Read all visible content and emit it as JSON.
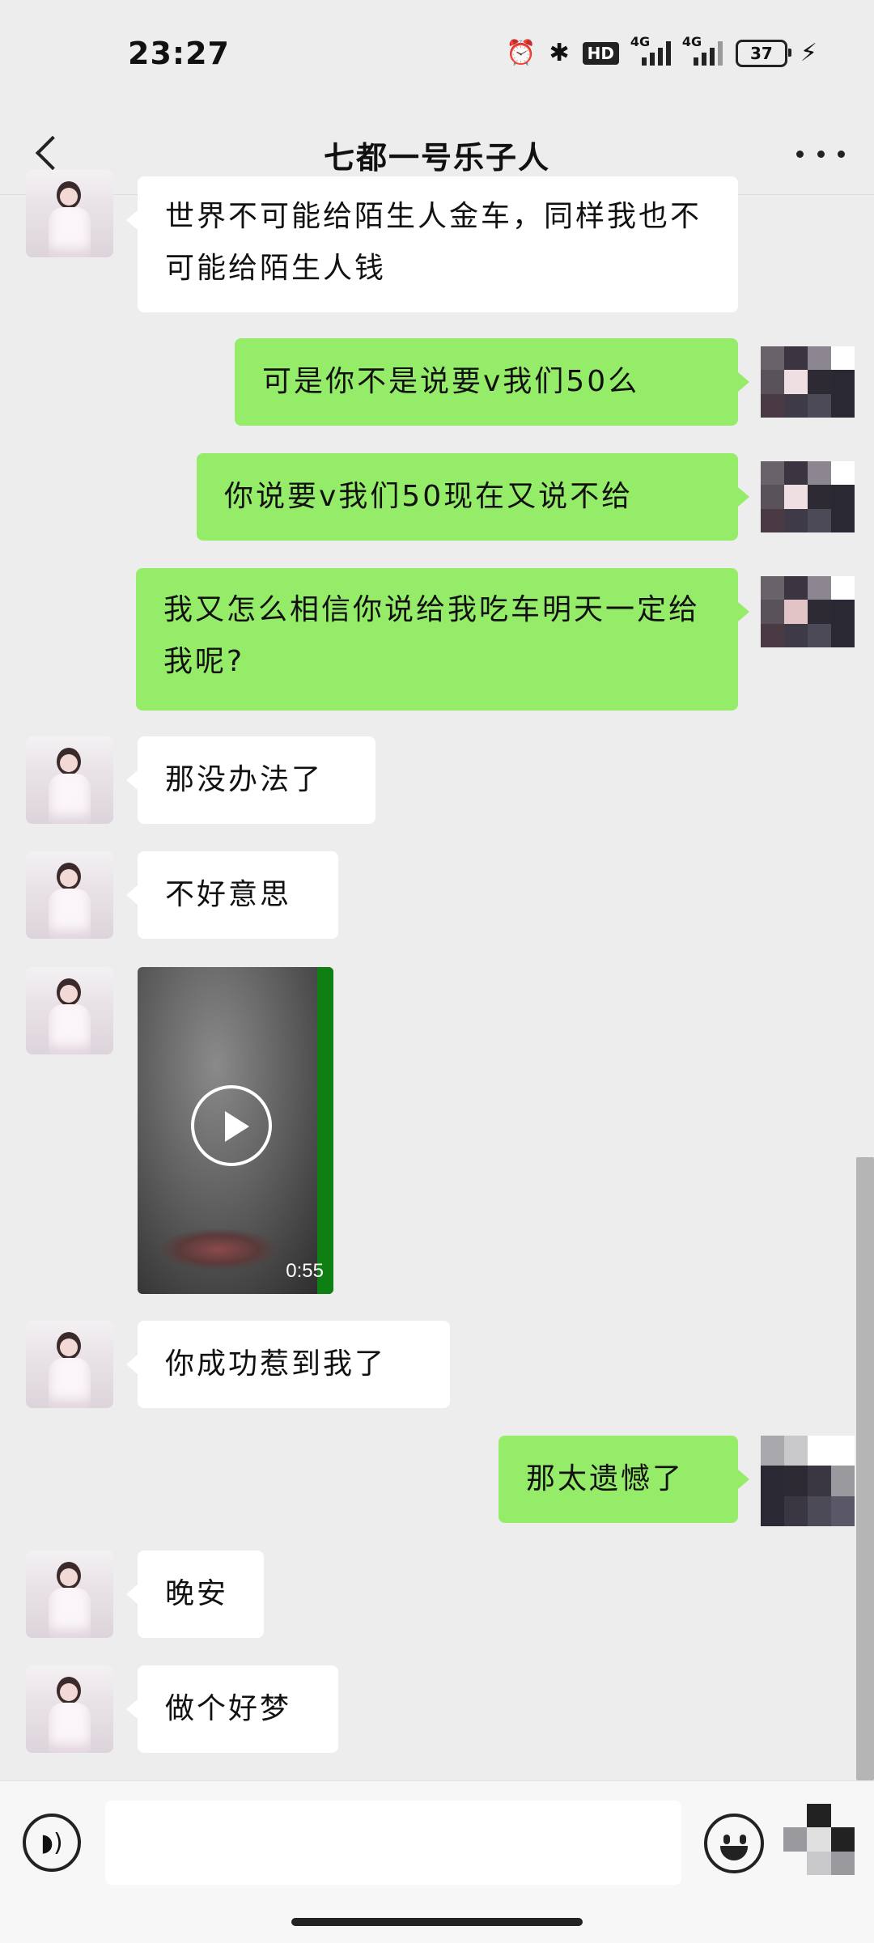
{
  "status_bar": {
    "time": "23:27",
    "alarm_icon": "⏰",
    "bluetooth_icon": "✱",
    "hd_label": "HD",
    "network_1": "4G",
    "network_2": "4G",
    "battery": "37",
    "charging_icon": "⚡"
  },
  "header": {
    "title": "七都一号乐子人"
  },
  "messages": [
    {
      "side": "left",
      "text": "世界不可能给陌生人金车，同样我也不可能给陌生人钱"
    },
    {
      "side": "right",
      "text": "可是你不是说要v我们50么"
    },
    {
      "side": "right",
      "text": "你说要v我们50现在又说不给"
    },
    {
      "side": "right",
      "text": "我又怎么相信你说给我吃车明天一定给我呢?"
    },
    {
      "side": "left",
      "text": "那没办法了"
    },
    {
      "side": "left",
      "text": "不好意思"
    },
    {
      "side": "left",
      "type": "video",
      "duration": "0:55"
    },
    {
      "side": "left",
      "text": "你成功惹到我了"
    },
    {
      "side": "right",
      "text": "那太遗憾了"
    },
    {
      "side": "left",
      "text": "晚安"
    },
    {
      "side": "left",
      "text": "做个好梦"
    }
  ],
  "input_bar": {
    "voice_icon": "voice-icon",
    "emoji_icon": "emoji-icon",
    "more_icon": "plus-icon",
    "placeholder": ""
  },
  "colors": {
    "background": "#ededed",
    "self_bubble": "#95ec69",
    "other_bubble": "#ffffff"
  }
}
